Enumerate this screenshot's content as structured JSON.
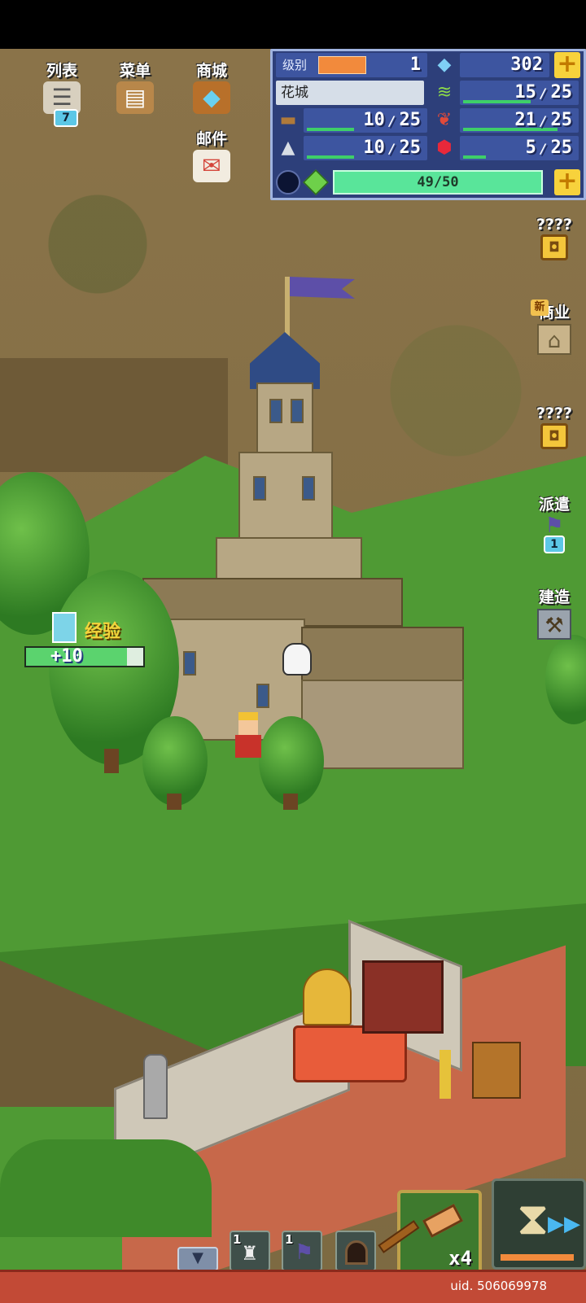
{
  "topmenu": {
    "list_label": "列表",
    "list_badge": "7",
    "menu_label": "菜单",
    "shop_label": "商城",
    "mail_label": "邮件"
  },
  "stats": {
    "level_label": "级别",
    "level_value": "1",
    "level_progress": 0.6,
    "gems": "302",
    "city_name": "花城",
    "grass": {
      "current": "15",
      "max": "25",
      "fill": 0.6
    },
    "wood": {
      "current": "10",
      "max": "25",
      "fill": 0.4
    },
    "food": {
      "current": "21",
      "max": "25",
      "fill": 0.84
    },
    "ore": {
      "current": "10",
      "max": "25",
      "fill": 0.4
    },
    "ruby": {
      "current": "5",
      "max": "25",
      "fill": 0.2
    },
    "energy": "49/50",
    "slash": "/"
  },
  "side": {
    "locked1_label": "????",
    "commerce_label": "商业",
    "new_tag": "新",
    "locked2_label": "????",
    "dispatch_label": "派遣",
    "dispatch_badge": "1",
    "build_label": "建造"
  },
  "exp_popup": {
    "label": "经验",
    "value": "+10",
    "fill": 0.86
  },
  "bottom": {
    "slot1_num": "1",
    "slot2_num": "1",
    "hammer_count": "x4",
    "uid": "uid. 506069978"
  },
  "colors": {
    "panel_bg": "#2d3f7a",
    "accent_yellow": "#f7d23c",
    "energy_green": "#59e59a",
    "bottom_red": "#c24a36"
  }
}
